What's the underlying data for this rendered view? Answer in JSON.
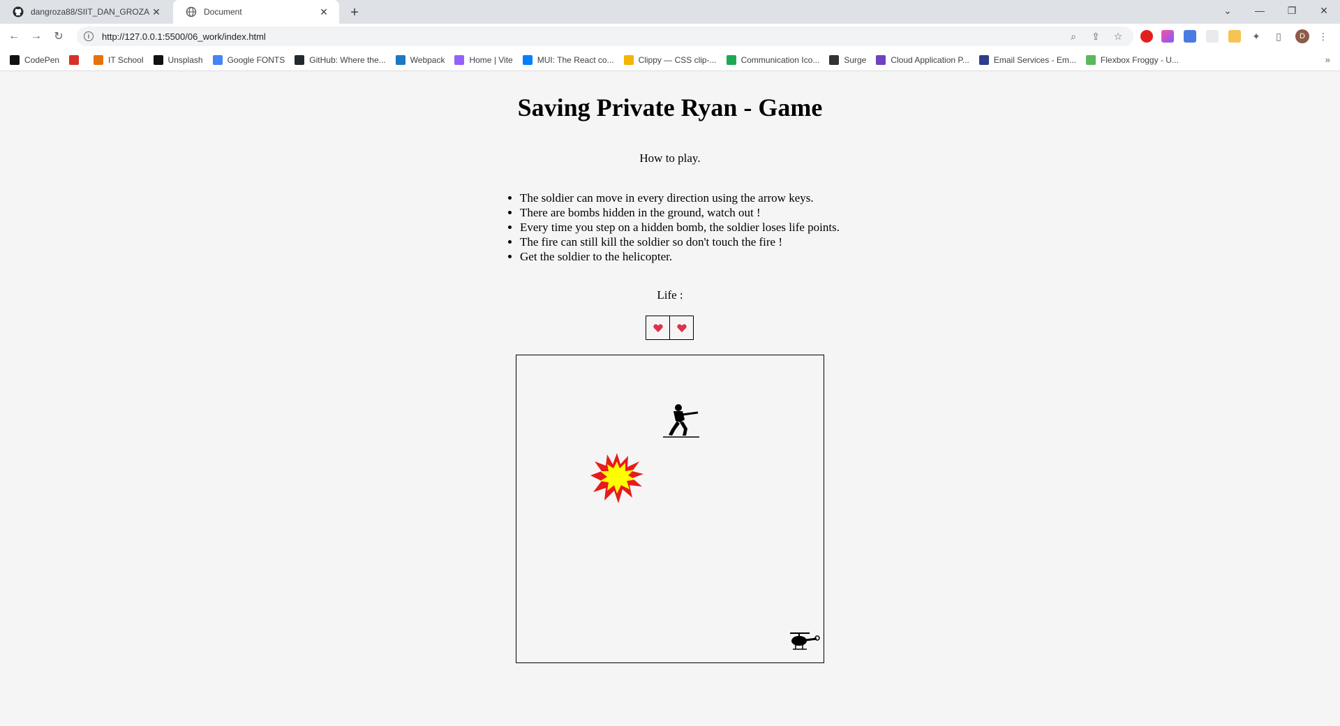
{
  "browser": {
    "tabs": [
      {
        "title": "dangroza88/SIIT_DAN_GROZA",
        "icon": "github-icon",
        "active": false
      },
      {
        "title": "Document",
        "icon": "globe-icon",
        "active": true
      }
    ],
    "url": "http://127.0.0.1:5500/06_work/index.html",
    "profile_initial": "D",
    "bookmarks": [
      {
        "label": "CodePen",
        "color": "#111111"
      },
      {
        "label": "",
        "color": "#d93025"
      },
      {
        "label": "IT School",
        "color": "#e8710a"
      },
      {
        "label": "Unsplash",
        "color": "#111111"
      },
      {
        "label": "Google FONTS",
        "color": "#4285f4"
      },
      {
        "label": "GitHub: Where the...",
        "color": "#24292e"
      },
      {
        "label": "Webpack",
        "color": "#1c78c0"
      },
      {
        "label": "Home | Vite",
        "color": "#9461ff"
      },
      {
        "label": "MUI: The React co...",
        "color": "#007fff"
      },
      {
        "label": "Clippy — CSS clip-...",
        "color": "#f4b400"
      },
      {
        "label": "Communication Ico...",
        "color": "#1aaa55"
      },
      {
        "label": "Surge",
        "color": "#333333"
      },
      {
        "label": "Cloud Application P...",
        "color": "#6f42c1"
      },
      {
        "label": "Email Services - Em...",
        "color": "#2f3b8f"
      },
      {
        "label": "Flexbox Froggy - U...",
        "color": "#5cb85c"
      }
    ]
  },
  "page": {
    "title": "Saving Private Ryan - Game",
    "howto": "How to play.",
    "rules": [
      "The soldier can move in every direction using the arrow keys.",
      "There are bombs hidden in the ground, watch out !",
      "Every time you step on a hidden bomb, the soldier loses life points.",
      "The fire can still kill the soldier so don't touch the fire !",
      "Get the soldier to the helicopter."
    ],
    "life_label": "Life :",
    "lives": 2,
    "heart_color": "#e0314b"
  }
}
